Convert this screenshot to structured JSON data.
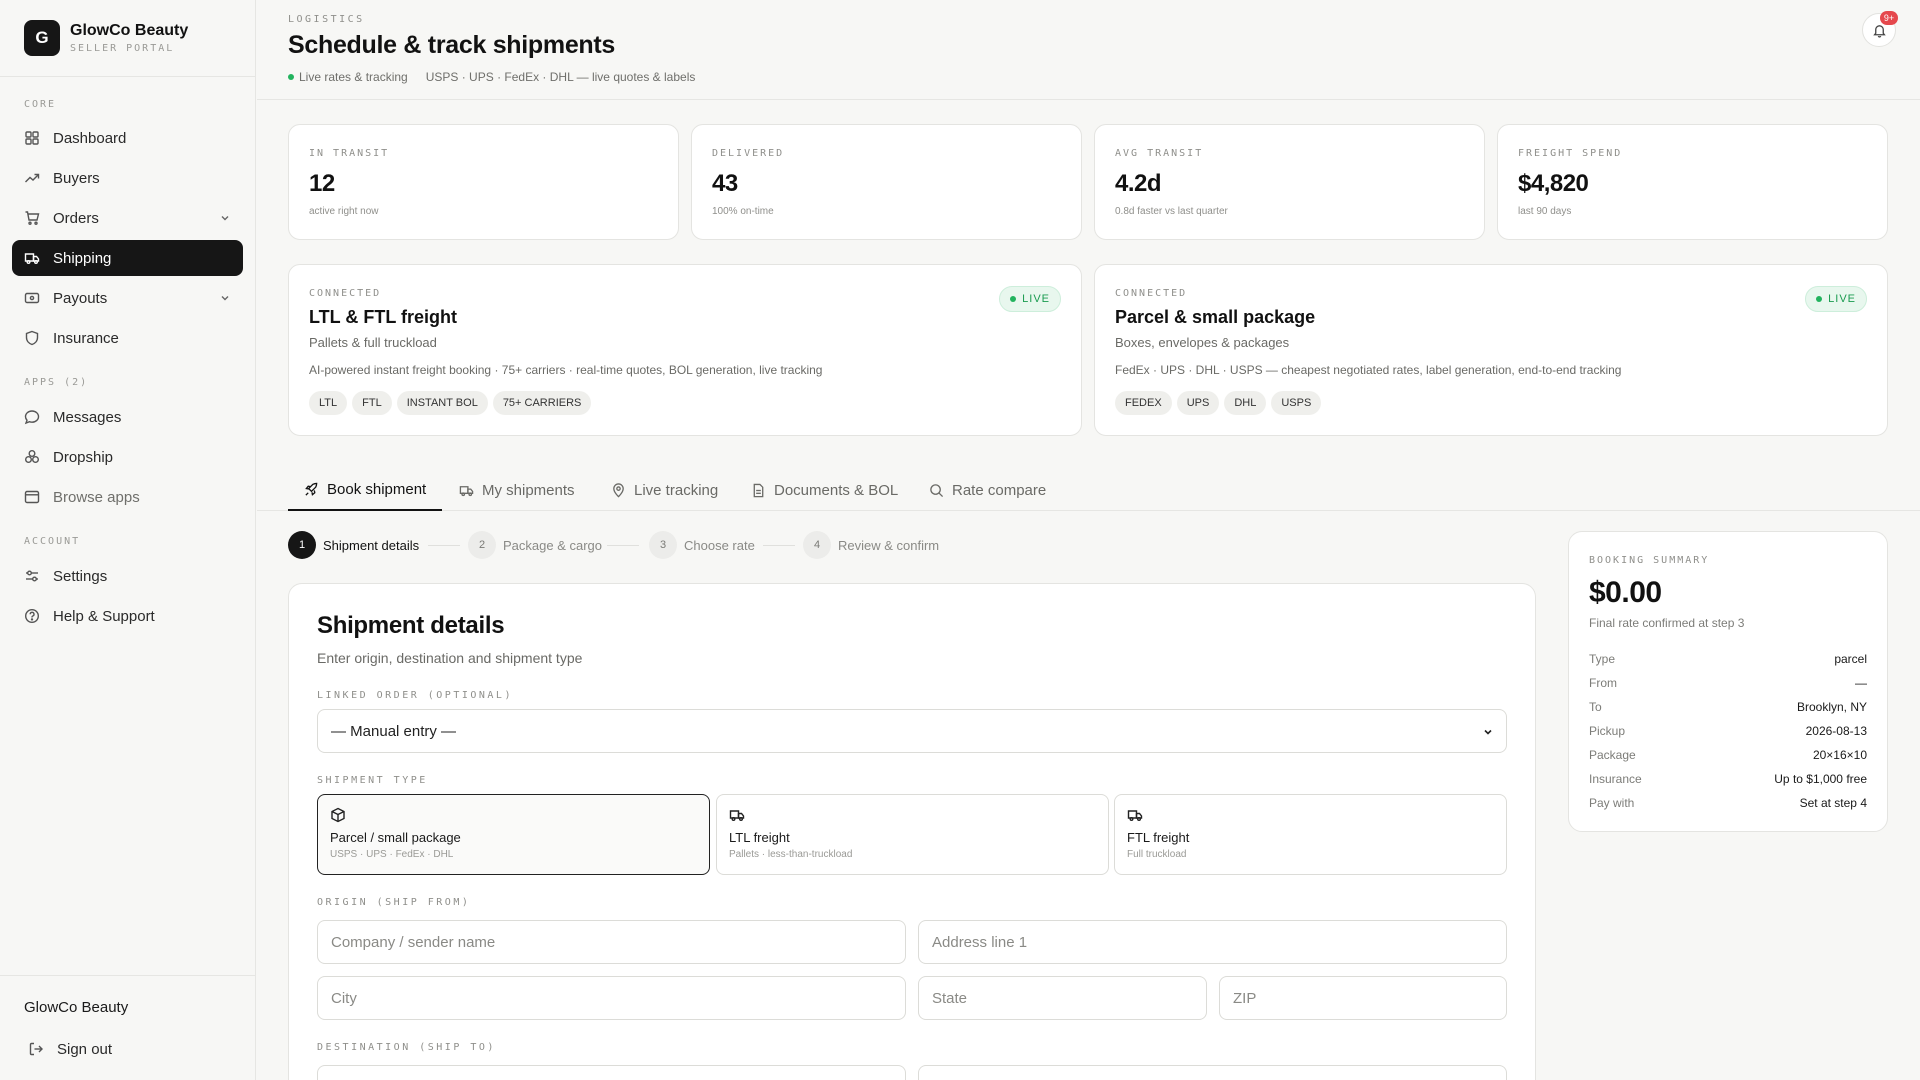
{
  "brand": {
    "initial": "G",
    "name": "GlowCo Beauty",
    "subtitle": "SELLER PORTAL"
  },
  "sidebar": {
    "sections": {
      "core": "CORE",
      "apps": "APPS  (2)",
      "account": "ACCOUNT"
    },
    "items": {
      "dashboard": "Dashboard",
      "buyers": "Buyers",
      "orders": "Orders",
      "shipping": "Shipping",
      "payouts": "Payouts",
      "insurance": "Insurance",
      "messages": "Messages",
      "dropship": "Dropship",
      "browse_apps": "Browse apps",
      "settings": "Settings",
      "help": "Help & Support"
    },
    "active": "shipping",
    "footer": {
      "account_name": "GlowCo Beauty",
      "sign_out": "Sign out"
    }
  },
  "header": {
    "eyebrow": "LOGISTICS",
    "title": "Schedule & track shipments",
    "status": "Live rates & tracking",
    "carriers_note": "USPS · UPS · FedEx · DHL — live quotes & labels",
    "notification_badge": "9+"
  },
  "stats": [
    {
      "label": "IN TRANSIT",
      "value": "12",
      "sub": "active right now"
    },
    {
      "label": "DELIVERED",
      "value": "43",
      "sub": "100% on-time"
    },
    {
      "label": "AVG TRANSIT",
      "value": "4.2d",
      "sub": "0.8d faster vs last quarter"
    },
    {
      "label": "FREIGHT SPEND",
      "value": "$4,820",
      "sub": "last 90 days"
    }
  ],
  "connections": [
    {
      "eyebrow": "CONNECTED",
      "title": "LTL & FTL freight",
      "subtitle": "Pallets & full truckload",
      "description": "AI-powered instant freight booking · 75+ carriers · real-time quotes, BOL generation, live tracking",
      "badge": "LIVE",
      "chips": [
        "LTL",
        "FTL",
        "INSTANT BOL",
        "75+ CARRIERS"
      ]
    },
    {
      "eyebrow": "CONNECTED",
      "title": "Parcel & small package",
      "subtitle": "Boxes, envelopes & packages",
      "description": "FedEx · UPS · DHL · USPS — cheapest negotiated rates, label generation, end-to-end tracking",
      "badge": "LIVE",
      "chips": [
        "FEDEX",
        "UPS",
        "DHL",
        "USPS"
      ]
    }
  ],
  "tabs": {
    "book": "Book shipment",
    "my_shipments": "My shipments",
    "live_tracking": "Live tracking",
    "documents": "Documents & BOL",
    "rate_compare": "Rate compare",
    "active": "book"
  },
  "stepper": [
    {
      "num": "1",
      "label": "Shipment details"
    },
    {
      "num": "2",
      "label": "Package & cargo"
    },
    {
      "num": "3",
      "label": "Choose rate"
    },
    {
      "num": "4",
      "label": "Review & confirm"
    }
  ],
  "form": {
    "title": "Shipment details",
    "subtitle": "Enter origin, destination and shipment type",
    "linked_order_label": "LINKED ORDER (OPTIONAL)",
    "linked_order_value": "— Manual entry —",
    "shipment_type_label": "SHIPMENT TYPE",
    "shipment_types": [
      {
        "title": "Parcel / small package",
        "sub": "USPS · UPS · FedEx · DHL",
        "icon": "package-icon"
      },
      {
        "title": "LTL freight",
        "sub": "Pallets · less-than-truckload",
        "icon": "truck-icon"
      },
      {
        "title": "FTL freight",
        "sub": "Full truckload",
        "icon": "truck-icon"
      }
    ],
    "selected_type": "Parcel / small package",
    "origin_label": "ORIGIN (SHIP FROM)",
    "placeholders": {
      "company": "Company / sender name",
      "address1": "Address line 1",
      "city": "City",
      "state": "State",
      "zip": "ZIP"
    },
    "destination_label": "DESTINATION (SHIP TO)"
  },
  "summary": {
    "eyebrow": "BOOKING SUMMARY",
    "total": "$0.00",
    "note": "Final rate confirmed at step 3",
    "rows": [
      {
        "k": "Type",
        "v": "parcel"
      },
      {
        "k": "From",
        "v": "—"
      },
      {
        "k": "To",
        "v": "Brooklyn, NY"
      },
      {
        "k": "Pickup",
        "v": "2026-08-13"
      },
      {
        "k": "Package",
        "v": "20×16×10"
      },
      {
        "k": "Insurance",
        "v": "Up to $1,000 free"
      },
      {
        "k": "Pay with",
        "v": "Set at step 4"
      }
    ]
  },
  "colors": {
    "accent": "#161616",
    "live": "#22b35e",
    "badge": "#e5484d"
  }
}
